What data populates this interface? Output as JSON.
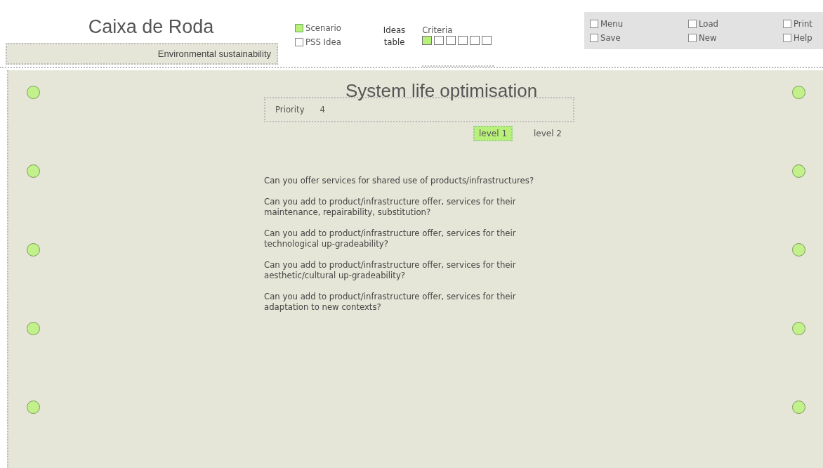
{
  "header": {
    "title": "Caixa de Roda",
    "subtitle": "Environmental sustainability"
  },
  "nav": [
    {
      "label": "Scenario",
      "selected": true
    },
    {
      "label": "PSS Idea",
      "selected": false
    }
  ],
  "ideas_table": {
    "line_1": "Ideas",
    "line_2": "table"
  },
  "criteria": {
    "label": "Criteria",
    "steps": [
      {
        "selected": true
      },
      {
        "selected": false
      },
      {
        "selected": false
      },
      {
        "selected": false
      },
      {
        "selected": false
      },
      {
        "selected": false
      }
    ]
  },
  "menu": [
    {
      "label": "Menu",
      "checked": false
    },
    {
      "label": "Load",
      "checked": false
    },
    {
      "label": "Print",
      "checked": false
    },
    {
      "label": "Save",
      "checked": false
    },
    {
      "label": "New",
      "checked": false
    },
    {
      "label": "Help",
      "checked": false
    }
  ],
  "main": {
    "title": "System life optimisation",
    "priority_label": "Priority",
    "priority_value": "4",
    "levels": [
      {
        "label": "level 1",
        "selected": true
      },
      {
        "label": "level 2",
        "selected": false
      }
    ],
    "questions": [
      "Can you offer services for shared use of products/infrastructures?",
      "Can you add to product/infrastructure offer, services for their maintenance, repairability, substitution?",
      "Can you add to product/infrastructure offer, services for their technological up-gradeability?",
      "Can you add to product/infrastructure offer, services for their aesthetic/cultural up-gradeability?",
      "Can you add to product/infrastructure offer, services for their adaptation to new contexts?"
    ]
  }
}
